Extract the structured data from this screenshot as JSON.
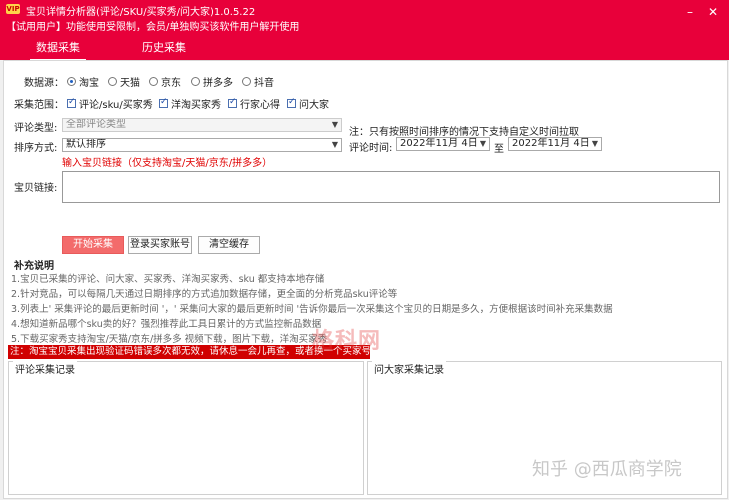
{
  "titlebar": {
    "badge": "VIP",
    "title": "宝贝详情分析器(评论/SKU/买家秀/问大家)1.0.5.22",
    "notice": "【试用用户】功能使用受限制，会员/单独购买该软件用户解开使用",
    "min": "–",
    "close": "✕"
  },
  "tabs": [
    {
      "label": "数据采集",
      "active": true
    },
    {
      "label": "历史采集",
      "active": false
    }
  ],
  "form": {
    "source_label": "数据源：",
    "sources": [
      {
        "label": "淘宝",
        "checked": true
      },
      {
        "label": "天猫",
        "checked": false
      },
      {
        "label": "京东",
        "checked": false
      },
      {
        "label": "拼多多",
        "checked": false
      },
      {
        "label": "抖音",
        "checked": false
      }
    ],
    "scope_label": "采集范围：",
    "scopes": [
      {
        "label": "评论/sku/买家秀",
        "checked": true
      },
      {
        "label": "洋淘买家秀",
        "checked": true
      },
      {
        "label": "行家心得",
        "checked": true
      },
      {
        "label": "问大家",
        "checked": true
      }
    ],
    "comment_type_label": "评论类型:",
    "comment_type_value": "全部评论类型",
    "comment_type_note": "注：只有按照时间排序的情况下支持自定义时间拉取",
    "sort_label": "排序方式:",
    "sort_value": "默认排序",
    "comment_time_label": "评论时间:",
    "date_from": "2022年11月 4日",
    "date_sep": "至",
    "date_to": "2022年11月 4日",
    "link_hint": "输入宝贝链接（仅支持淘宝/天猫/京东/拼多多）",
    "link_label": "宝贝链接:"
  },
  "buttons": {
    "start": "开始采集",
    "login": "登录买家账号",
    "clear": "清空缓存"
  },
  "notes": {
    "title": "补充说明",
    "lines": [
      "1.宝贝已采集的评论、问大家、买家秀、洋淘买家秀、sku 都支持本地存储",
      "2.针对竞品，可以每隔几天通过日期排序的方式追加数据存储，更全面的分析竞品sku评论等",
      "3.列表上' 采集评论的最后更新时间 '，' 采集问大家的最后更新时间 '告诉你最后一次采集这个宝贝的日期是多久，方便根据该时间补充采集数据",
      "4.想知道新品哪个sku卖的好？强烈推荐此工具日累计的方式监控新品数据",
      "5.下载买家秀支持淘宝/天猫/京东/拼多多 视频下载，图片下载，洋淘买家秀"
    ],
    "warning": "注：淘宝宝贝采集出现验证码错误多次都无效，请休息一会儿再查，或者换一个买家号登录"
  },
  "groups": {
    "comments": "评论采集记录",
    "questions": "问大家采集记录"
  },
  "watermark": "格科网",
  "footer_watermark": "知乎 @西瓜商学院"
}
